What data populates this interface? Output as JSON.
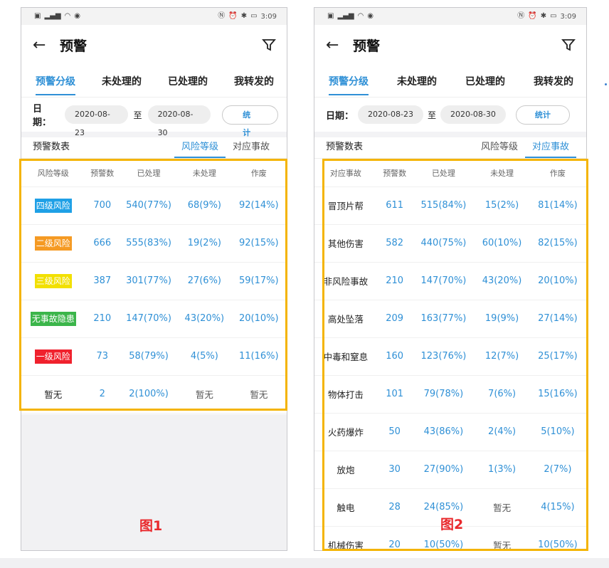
{
  "status_bar": {
    "time": "3:09"
  },
  "colors": {
    "accent": "#2f90d6",
    "highlight": "#f4b400",
    "caption": "#e9292d"
  },
  "app": {
    "title": "预警"
  },
  "tabs": [
    "预警分级",
    "未处理的",
    "已处理的",
    "我转发的"
  ],
  "dates": {
    "label": "日期：",
    "start": "2020-08-23",
    "to": "至",
    "end": "2020-08-30",
    "stat_button": "统计"
  },
  "subbar": {
    "title": "预警数表",
    "tab_risk": "风险等级",
    "tab_accident": "对应事故"
  },
  "screen1": {
    "caption": "图1",
    "headers": [
      "风险等级",
      "预警数",
      "已处理",
      "未处理",
      "作废"
    ],
    "rows": [
      {
        "level": "四级风险",
        "color": "#1fa0e6",
        "count": "700",
        "handled": "540(77%)",
        "unhandled": "68(9%)",
        "void": "92(14%)"
      },
      {
        "level": "二级风险",
        "color": "#f59a23",
        "count": "666",
        "handled": "555(83%)",
        "unhandled": "19(2%)",
        "void": "92(15%)"
      },
      {
        "level": "三级风险",
        "color": "#f2e000",
        "count": "387",
        "handled": "301(77%)",
        "unhandled": "27(6%)",
        "void": "59(17%)"
      },
      {
        "level": "无事故隐患",
        "color": "#3bb54a",
        "count": "210",
        "handled": "147(70%)",
        "unhandled": "43(20%)",
        "void": "20(10%)"
      },
      {
        "level": "一级风险",
        "color": "#f0212d",
        "count": "73",
        "handled": "58(79%)",
        "unhandled": "4(5%)",
        "void": "11(16%)"
      },
      {
        "level": "暂无",
        "color": "",
        "count": "2",
        "handled": "2(100%)",
        "unhandled": "暂无",
        "void": "暂无"
      }
    ]
  },
  "screen2": {
    "caption": "图2",
    "headers": [
      "对应事故",
      "预警数",
      "已处理",
      "未处理",
      "作废"
    ],
    "rows": [
      {
        "name": "冒顶片帮",
        "count": "611",
        "handled": "515(84%)",
        "unhandled": "15(2%)",
        "void": "81(14%)"
      },
      {
        "name": "其他伤害",
        "count": "582",
        "handled": "440(75%)",
        "unhandled": "60(10%)",
        "void": "82(15%)"
      },
      {
        "name": "非风险事故",
        "count": "210",
        "handled": "147(70%)",
        "unhandled": "43(20%)",
        "void": "20(10%)"
      },
      {
        "name": "高处坠落",
        "count": "209",
        "handled": "163(77%)",
        "unhandled": "19(9%)",
        "void": "27(14%)"
      },
      {
        "name": "中毒和窒息",
        "count": "160",
        "handled": "123(76%)",
        "unhandled": "12(7%)",
        "void": "25(17%)"
      },
      {
        "name": "物体打击",
        "count": "101",
        "handled": "79(78%)",
        "unhandled": "7(6%)",
        "void": "15(16%)"
      },
      {
        "name": "火药爆炸",
        "count": "50",
        "handled": "43(86%)",
        "unhandled": "2(4%)",
        "void": "5(10%)"
      },
      {
        "name": "放炮",
        "count": "30",
        "handled": "27(90%)",
        "unhandled": "1(3%)",
        "void": "2(7%)"
      },
      {
        "name": "触电",
        "count": "28",
        "handled": "24(85%)",
        "unhandled": "暂无",
        "void": "4(15%)"
      },
      {
        "name": "机械伤害",
        "count": "20",
        "handled": "10(50%)",
        "unhandled": "暂无",
        "void": "10(50%)"
      }
    ]
  }
}
